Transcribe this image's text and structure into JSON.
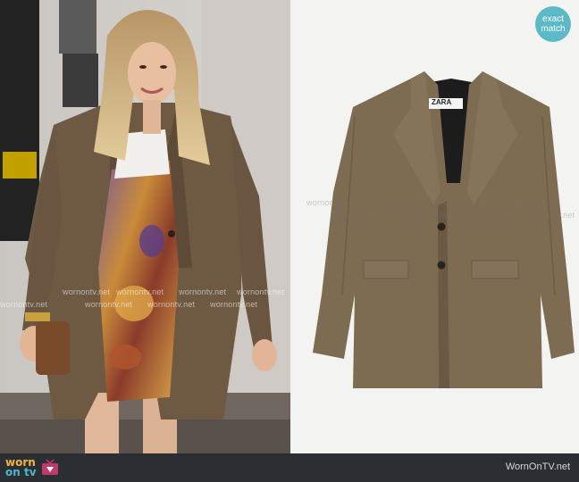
{
  "watermark": {
    "text": "wornontv.net"
  },
  "badge": {
    "line1": "exact",
    "line2": "match"
  },
  "footer": {
    "logo_line1": "worn",
    "logo_line2": "on tv",
    "credit": "WornOnTV.net"
  },
  "garment_label": {
    "brand": "ZARA"
  },
  "colors": {
    "blazer": "#7d6b52",
    "badge": "#5cb9c8",
    "footer": "#2b2f33",
    "logo_yellow": "#f3b53f",
    "logo_teal": "#4db8c9"
  }
}
